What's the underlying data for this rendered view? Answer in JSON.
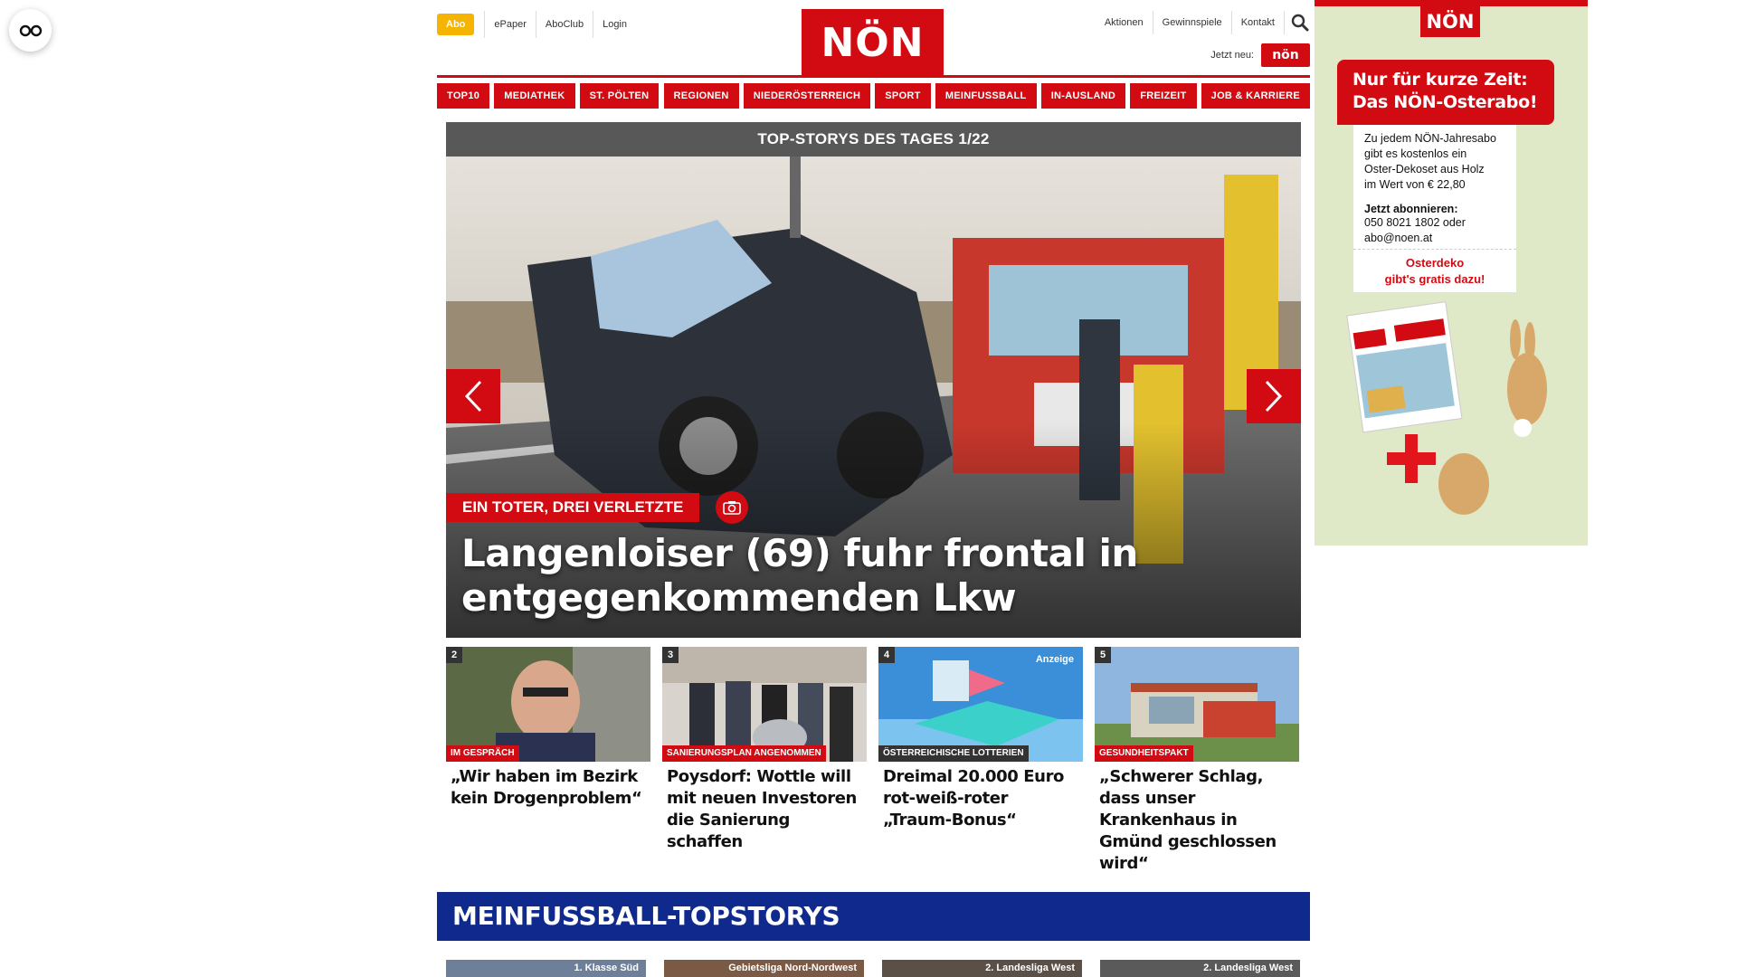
{
  "header": {
    "abo_label": "Abo",
    "top_links": [
      "ePaper",
      "AboClub",
      "Login"
    ],
    "logo_text": "NÖN",
    "right_links": [
      "Aktionen",
      "Gewinnspiele",
      "Kontakt"
    ],
    "jetzt_neu_label": "Jetzt neu:",
    "jetzt_neu_logo": "nön"
  },
  "nav": {
    "items": [
      "TOP10",
      "MEDIATHEK",
      "ST. PÖLTEN",
      "REGIONEN",
      "NIEDERÖSTERREICH",
      "SPORT",
      "MEINFUSSBALL",
      "IN-AUSLAND",
      "FREIZEIT",
      "JOB & KARRIERE"
    ]
  },
  "slider": {
    "title": "TOP-STORYS DES TAGES 1/22",
    "kicker": "EIN TOTER, DREI VERLETZTE",
    "headline": "Langenloiser (69) fuhr frontal in entgegenkommenden Lkw"
  },
  "teasers": [
    {
      "num": "2",
      "tag": "IM GESPRÄCH",
      "title": "„Wir haben im Bezirk kein Drogenproblem“",
      "ad": ""
    },
    {
      "num": "3",
      "tag": "SANIERUNGSPLAN ANGENOMMEN",
      "title": "Poysdorf: Wottle will mit neuen Investoren die Sanierung schaffen",
      "ad": ""
    },
    {
      "num": "4",
      "tag": "ÖSTERREICHISCHE LOTTERIEN",
      "title": "Dreimal 20.000 Euro rot-weiß-roter „Traum-Bonus“",
      "ad": "Anzeige"
    },
    {
      "num": "5",
      "tag": "GESUNDHEITSPAKT",
      "title": "„Schwerer Schlag, dass unser Krankenhaus in Gmünd geschlossen wird“",
      "ad": ""
    }
  ],
  "meinfussball": {
    "title": "MEINFUSSBALL-TOPSTORYS",
    "cards": [
      "1. Klasse Süd",
      "Gebietsliga Nord-Nordwest",
      "2. Landesliga West",
      "2. Landesliga West"
    ]
  },
  "ad": {
    "logo": "NÖN",
    "headline_1": "Nur für kurze Zeit:",
    "headline_2": "Das NÖN-Osterabo!",
    "body_1": "Zu jedem NÖN-Jahresabo",
    "body_2": "gibt es kostenlos ein",
    "body_3": "Oster-Dekoset aus Holz",
    "body_4": "im Wert von € 22,80",
    "cta": "Jetzt abonnieren:",
    "phone": "050 8021 1802 oder",
    "email": "abo@noen.at",
    "osterdeko_1": "Osterdeko",
    "osterdeko_2": "gibt's gratis dazu!",
    "paper_logo": "NÖN"
  },
  "colors": {
    "brand_red": "#d20a11",
    "abo_yellow": "#f5b400",
    "mf_blue": "#0f2a8c"
  }
}
